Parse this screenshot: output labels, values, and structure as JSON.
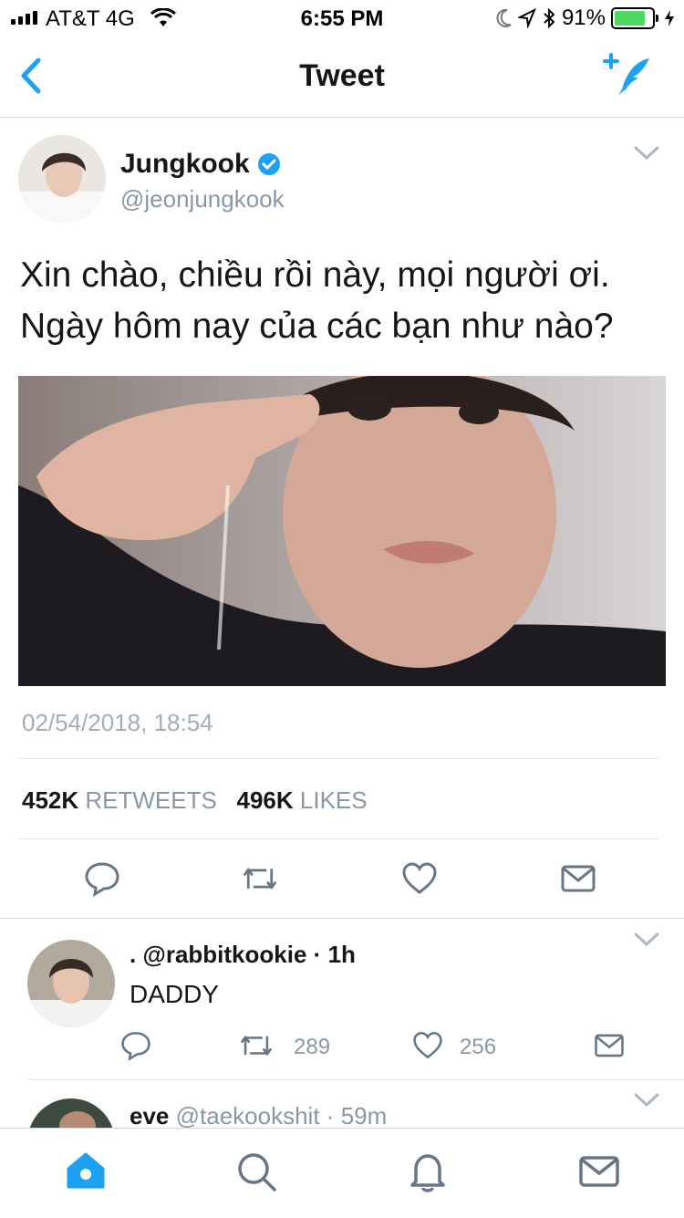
{
  "status_bar": {
    "carrier": "AT&T 4G",
    "time": "6:55 PM",
    "battery": "91%",
    "battery_level": 0.91
  },
  "nav": {
    "title": "Tweet",
    "back_icon": "chevron-left-icon",
    "compose_icon": "compose-tweet-icon"
  },
  "tweet": {
    "name": "Jungkook",
    "verified": true,
    "handle": "@jeonjungkook",
    "text_line1": "Xin chào, chiều rồi này, mọi người ơi.",
    "text_line2": "Ngày hôm nay của các bạn như nào?",
    "timestamp": "02/54/2018, 18:54",
    "retweets_count": "452K",
    "retweets_label": "RETWEETS",
    "likes_count": "496K",
    "likes_label": "LIKES"
  },
  "replies": [
    {
      "name": ".",
      "handle": "@rabbitkookie",
      "time": "1h",
      "text": "DADDY",
      "retweets": "289",
      "likes": "256"
    },
    {
      "name": "eve",
      "handle": "@taekookshit",
      "time": "59m"
    }
  ],
  "tabbar": {
    "items": [
      "home-icon",
      "search-icon",
      "notifications-icon",
      "messages-icon"
    ]
  },
  "colors": {
    "accent": "#1da1f2",
    "icon_grey": "#657786",
    "text_grey": "#8899a6"
  }
}
